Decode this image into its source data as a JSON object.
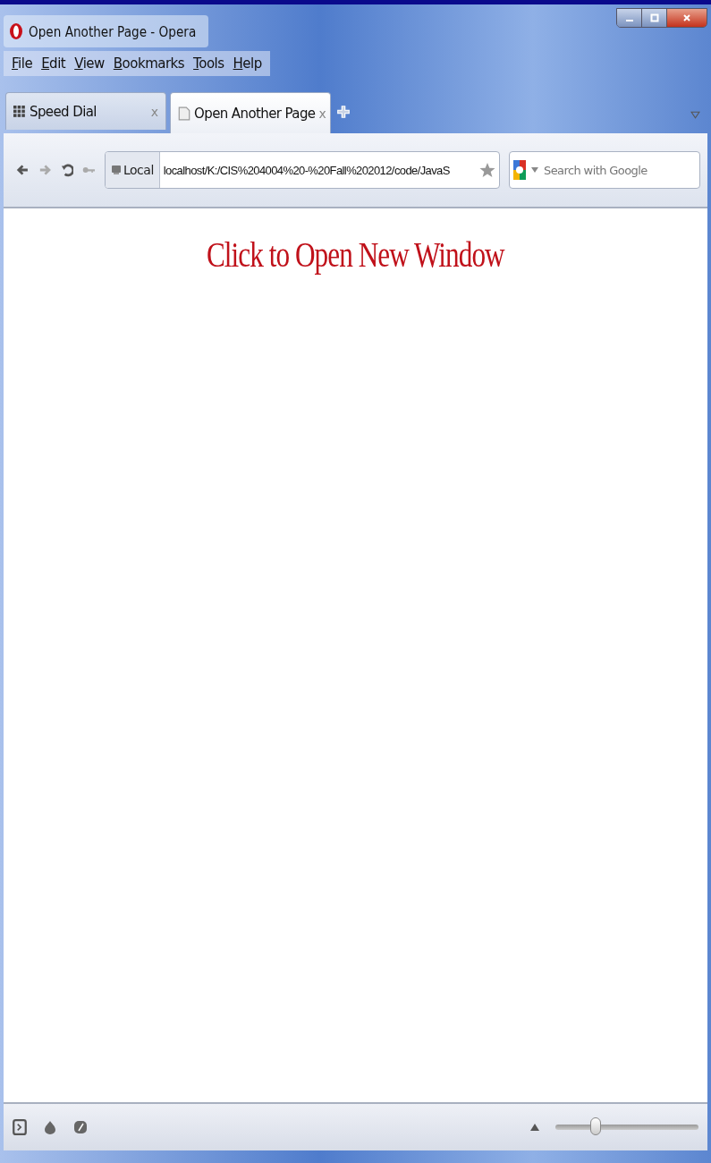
{
  "window": {
    "title": "Open Another Page - Opera"
  },
  "menu": [
    {
      "label": "File"
    },
    {
      "label": "Edit"
    },
    {
      "label": "View"
    },
    {
      "label": "Bookmarks"
    },
    {
      "label": "Tools"
    },
    {
      "label": "Help"
    }
  ],
  "tabs": [
    {
      "label": "Speed Dial",
      "kind": "speeddial",
      "selected": false,
      "close": "x"
    },
    {
      "label": "Open Another Page",
      "kind": "page",
      "selected": true,
      "close": "x"
    }
  ],
  "address_bar": {
    "badge": "Local",
    "url": "localhost/K:/CIS%204004%20-%20Fall%202012/code/JavaS"
  },
  "search": {
    "placeholder": "Search with Google"
  },
  "page": {
    "heading": "Click to Open New Window"
  },
  "status_bar": {
    "zoom": {
      "level": 0.28
    }
  }
}
